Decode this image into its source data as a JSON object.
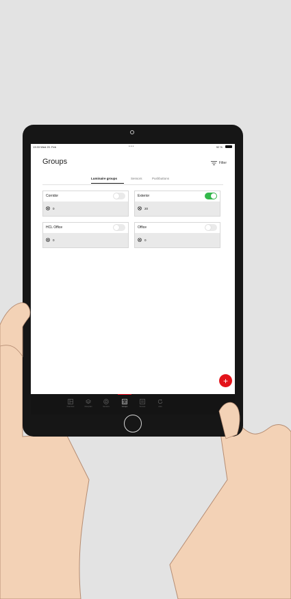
{
  "status_bar": {
    "time": "13:33  Wed 20. Feb",
    "dots": "•••",
    "battery": "92 %"
  },
  "header": {
    "title": "Groups",
    "filter_label": "Filter"
  },
  "tabs": [
    {
      "label": "Luminaire groups",
      "active": true
    },
    {
      "label": "Sensors",
      "active": false
    },
    {
      "label": "Pushbuttons",
      "active": false
    }
  ],
  "groups": [
    {
      "name": "Corridor",
      "count": "0",
      "enabled": false
    },
    {
      "name": "Exterior",
      "count": "20",
      "enabled": true
    },
    {
      "name": "HCL Office",
      "count": "0",
      "enabled": false
    },
    {
      "name": "Office",
      "count": "0",
      "enabled": false
    }
  ],
  "bottom_nav": [
    {
      "label": "Overview",
      "icon": "layout-icon"
    },
    {
      "label": "Floorplan",
      "icon": "layers-icon"
    },
    {
      "label": "Sensors",
      "icon": "target-icon"
    },
    {
      "label": "Groups",
      "icon": "grid-icon"
    },
    {
      "label": "Scenes",
      "icon": "scenes-icon"
    },
    {
      "label": "Auto",
      "icon": "auto-icon"
    }
  ],
  "colors": {
    "accent_red": "#e3131a",
    "toggle_on": "#33b84b",
    "nav_bg": "#141414",
    "page_bg": "#e3e3e3"
  }
}
